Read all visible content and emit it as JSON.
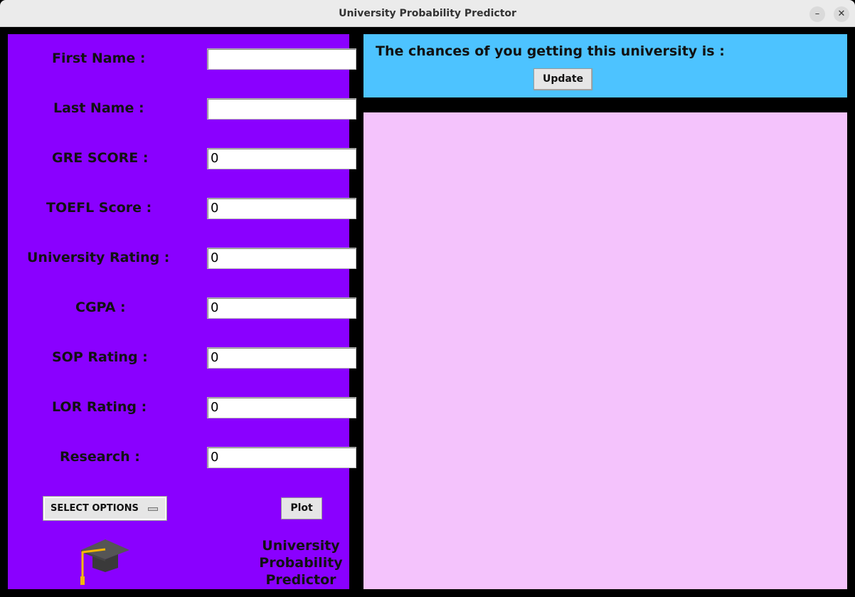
{
  "window": {
    "title": "University Probability Predictor",
    "minimize_glyph": "–",
    "close_glyph": "✕"
  },
  "form": {
    "fields": [
      {
        "label": "First Name :",
        "value": ""
      },
      {
        "label": "Last Name :",
        "value": ""
      },
      {
        "label": "GRE SCORE :",
        "value": "0"
      },
      {
        "label": "TOEFL Score :",
        "value": "0"
      },
      {
        "label": "University Rating :",
        "value": "0"
      },
      {
        "label": "CGPA :",
        "value": "0"
      },
      {
        "label": "SOP Rating :",
        "value": "0"
      },
      {
        "label": "LOR Rating :",
        "value": "0"
      },
      {
        "label": "Research :",
        "value": "0"
      }
    ],
    "select_label": "SELECT OPTIONS",
    "plot_label": "Plot"
  },
  "logo": {
    "icon": "graduation-cap-icon",
    "line1": "University",
    "line2": "Probability",
    "line3": "Predictor"
  },
  "result": {
    "text": "The chances of you getting this university is :",
    "update_label": "Update"
  },
  "colors": {
    "left_panel": "#8a00ff",
    "result_panel": "#4dc3ff",
    "plot_area": "#f4c3fc"
  }
}
